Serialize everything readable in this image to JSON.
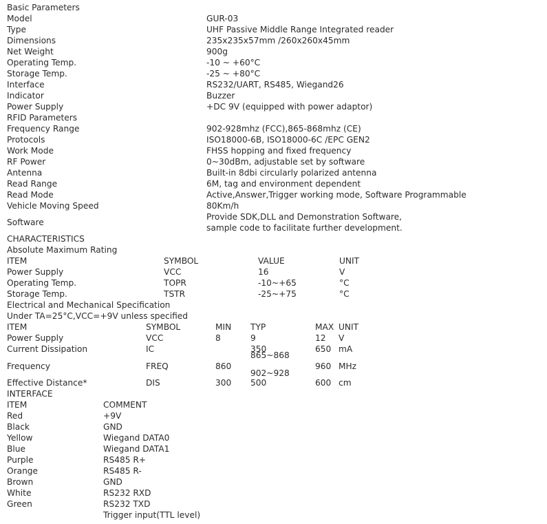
{
  "document": {
    "sections": {
      "basic_parameters": "Basic Parameters",
      "rfid_parameters": "RFID Parameters",
      "characteristics": "CHARACTERISTICS",
      "absolute_maximum_rating": "Absolute Maximum Rating",
      "electrical_spec": "Electrical and Mechanical Specification",
      "electrical_note": "Under TA=25°C,VCC=+9V unless specified",
      "interface": "INTERFACE"
    },
    "basic_parameters": [
      {
        "label": "Model",
        "value": "GUR-03"
      },
      {
        "label": "Type",
        "value": "UHF Passive Middle Range Integrated reader"
      },
      {
        "label": "Dimensions",
        "value": "235x235x57mm /260x260x45mm"
      },
      {
        "label": "Net Weight",
        "value": "900g"
      },
      {
        "label": "Operating Temp.",
        "value": "-10 ~ +60°C"
      },
      {
        "label": "Storage Temp.",
        "value": "-25 ~ +80°C"
      },
      {
        "label": "Interface",
        "value": "RS232/UART, RS485, Wiegand26"
      },
      {
        "label": "Indicator",
        "value": "Buzzer"
      },
      {
        "label": "Power Supply",
        "value": "+DC 9V (equipped with power adaptor)"
      }
    ],
    "rfid_parameters": [
      {
        "label": "Frequency Range",
        "value": "902-928mhz (FCC),865-868mhz (CE)"
      },
      {
        "label": "Protocols",
        "value": "ISO18000-6B, ISO18000-6C /EPC GEN2"
      },
      {
        "label": "Work Mode",
        "value": "FHSS hopping and fixed frequency"
      },
      {
        "label": "RF Power",
        "value": "0~30dBm, adjustable set by software"
      },
      {
        "label": "Antenna",
        "value": "Built-in 8dbi circularly polarized antenna"
      },
      {
        "label": "Read Range",
        "value": "6M, tag and environment dependent"
      },
      {
        "label": "Read Mode",
        "value": "Active,Answer,Trigger working mode, Software Programmable"
      },
      {
        "label": "Vehicle Moving Speed",
        "value": "80Km/h"
      }
    ],
    "software": {
      "label": "Software",
      "value_line1": "Provide SDK,DLL and Demonstration Software,",
      "value_line2": "sample code to facilitate further development."
    },
    "absolute_maximum_rating": {
      "headers": {
        "item": "ITEM",
        "symbol": "SYMBOL",
        "value": "VALUE",
        "unit": "UNIT"
      },
      "rows": [
        {
          "item": "Power Supply",
          "symbol": "VCC",
          "value": "16",
          "unit": "V"
        },
        {
          "item": "Operating Temp.",
          "symbol": "TOPR",
          "value": "-10~+65",
          "unit": "°C"
        },
        {
          "item": "Storage Temp.",
          "symbol": "TSTR",
          "value": "-25~+75",
          "unit": "°C"
        }
      ]
    },
    "electrical_spec": {
      "headers": {
        "item": "ITEM",
        "symbol": "SYMBOL",
        "min": "MIN",
        "typ": "TYP",
        "max": "MAX",
        "unit": "UNIT"
      },
      "rows": [
        {
          "item": "Power Supply",
          "symbol": "VCC",
          "min": "8",
          "typ": "9",
          "max": "12",
          "unit": "V"
        },
        {
          "item": "Current Dissipation",
          "symbol": "IC",
          "min": "",
          "typ": "350",
          "max": "650",
          "unit": "mA"
        },
        {
          "item": "Frequency",
          "symbol": "FREQ",
          "min": "860",
          "typ_line1": "865~868",
          "typ_line2": "902~928",
          "max": "960",
          "unit": "MHz"
        },
        {
          "item": "Effective Distance*",
          "symbol": "DIS",
          "min": "300",
          "typ": "500",
          "max": "600",
          "unit": "cm"
        }
      ]
    },
    "interface": {
      "headers": {
        "item": "ITEM",
        "comment": "COMMENT"
      },
      "rows": [
        {
          "item": "Red",
          "comment": "+9V"
        },
        {
          "item": "Black",
          "comment": "GND"
        },
        {
          "item": "Yellow",
          "comment": "Wiegand DATA0"
        },
        {
          "item": "Blue",
          "comment": "Wiegand DATA1"
        },
        {
          "item": "Purple",
          "comment": "RS485 R+"
        },
        {
          "item": "Orange",
          "comment": "RS485 R-"
        },
        {
          "item": "Brown",
          "comment": "GND"
        },
        {
          "item": "White",
          "comment": "RS232 RXD"
        },
        {
          "item": "Green",
          "comment": "RS232 TXD"
        },
        {
          "item": "",
          "comment": "Trigger input(TTL level)"
        }
      ]
    }
  }
}
